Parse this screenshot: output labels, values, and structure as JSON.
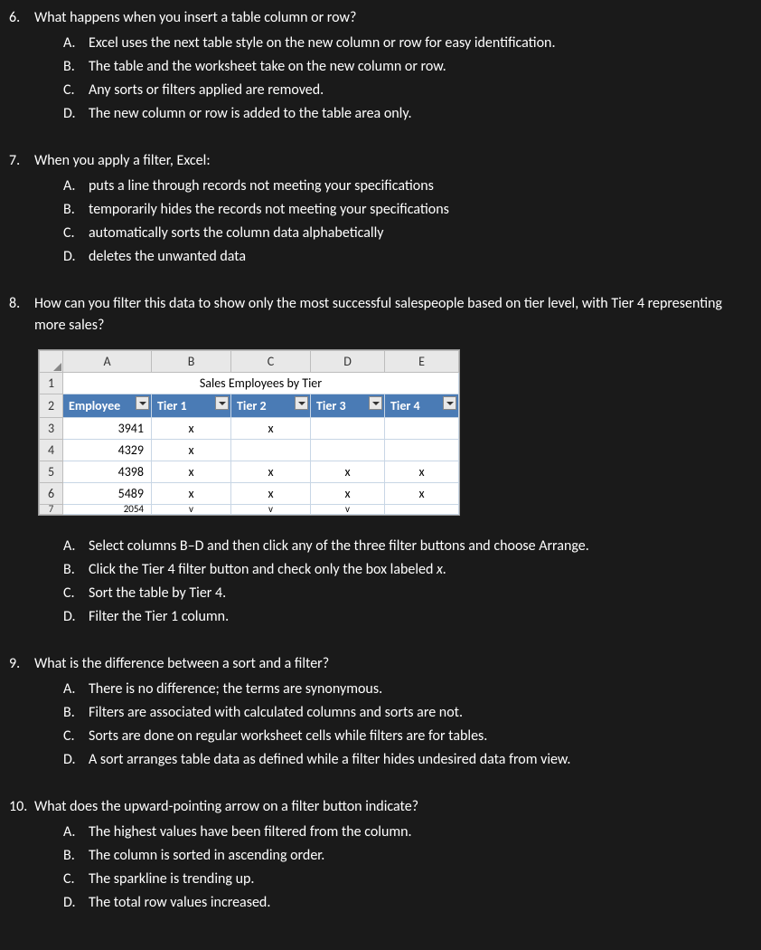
{
  "questions": [
    {
      "num": "6.",
      "text": "What happens when you insert a table column or row?",
      "options": {
        "A": "Excel uses the next table style on the new column or row for easy identification.",
        "B": "The table and the worksheet take on the new column or row.",
        "C": "Any sorts or filters applied are removed.",
        "D": "The new column or row is added to the table area only."
      }
    },
    {
      "num": "7.",
      "text": "When you apply a filter, Excel:",
      "options": {
        "A": "puts a line through records not meeting your specifications",
        "B": "temporarily hides the records not meeting your specifications",
        "C": "automatically sorts the column data alphabetically",
        "D": "deletes the unwanted data"
      }
    },
    {
      "num": "8.",
      "text": "How can you filter this data to show only the most successful salespeople based on tier level, with Tier 4 representing more sales?",
      "options": {
        "A": "Select columns B–D and then click any of the three filter buttons and choose Arrange.",
        "B_pre": "Click the Tier 4 filter button and check only the box labeled ",
        "B_ital": "x.",
        "C": "Sort the table by Tier 4.",
        "D": "Filter the Tier 1 column."
      }
    },
    {
      "num": "9.",
      "text": "What is the difference between a sort and a filter?",
      "options": {
        "A": "There is no difference; the terms are synonymous.",
        "B": "Filters are associated with calculated columns and sorts are not.",
        "C": "Sorts are done on regular worksheet cells while filters are for tables.",
        "D": "A sort arranges table data as defined while a filter hides undesired data from view."
      }
    },
    {
      "num": "10.",
      "text": "What does the upward-pointing arrow on a filter button indicate?",
      "options": {
        "A": "The highest values have been filtered from the column.",
        "B": "The column is sorted in ascending order.",
        "C": "The sparkline is trending up.",
        "D": "The total row values increased."
      }
    }
  ],
  "opt_labels": {
    "A": "A.",
    "B": "B.",
    "C": "C.",
    "D": "D."
  },
  "excel": {
    "col_headers": [
      "A",
      "B",
      "C",
      "D",
      "E"
    ],
    "row_headers": [
      "1",
      "2",
      "3",
      "4",
      "5",
      "6",
      "7"
    ],
    "title": "Sales Employees by Tier",
    "field_headers": [
      "Employee",
      "Tier 1",
      "Tier 2",
      "Tier 3",
      "Tier 4"
    ],
    "rows": [
      {
        "emp": "3941",
        "t1": "x",
        "t2": "x",
        "t3": "",
        "t4": ""
      },
      {
        "emp": "4329",
        "t1": "x",
        "t2": "",
        "t3": "",
        "t4": ""
      },
      {
        "emp": "4398",
        "t1": "x",
        "t2": "x",
        "t3": "x",
        "t4": "x"
      },
      {
        "emp": "5489",
        "t1": "x",
        "t2": "x",
        "t3": "x",
        "t4": "x"
      },
      {
        "emp": "2054",
        "t1": "v",
        "t2": "v",
        "t3": "v",
        "t4": ""
      }
    ]
  }
}
